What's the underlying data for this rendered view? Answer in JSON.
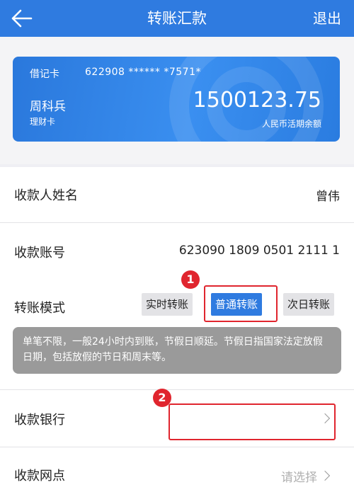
{
  "header": {
    "title": "转账汇款",
    "exit_label": "退出"
  },
  "card": {
    "type": "借记卡",
    "number": "622908  ******  *7571*",
    "holder_name": "周科兵",
    "product": "理财卡",
    "balance": "1500123.75",
    "balance_label": "人民币活期余额"
  },
  "form": {
    "payee_name_label": "收款人姓名",
    "payee_name_value": "曾伟",
    "account_label": "收款账号",
    "account_value": "623090 1809 0501 2111 1",
    "mode_label": "转账模式",
    "modes": [
      "实时转账",
      "普通转账",
      "次日转账"
    ],
    "selected_mode": "普通转账",
    "mode_note": "单笔不限，一般24小时内到账，节假日顺延。节假日指国家法定放假日期，包括放假的节日和周末等。",
    "bank_label": "收款银行",
    "branch_label": "收款网点",
    "branch_placeholder": "请选择"
  },
  "annotations": {
    "badge_1": "1",
    "badge_2": "2"
  },
  "colors": {
    "header": "#2f7be0",
    "highlight": "#e0252e",
    "note_bg": "#9a9a9a"
  }
}
